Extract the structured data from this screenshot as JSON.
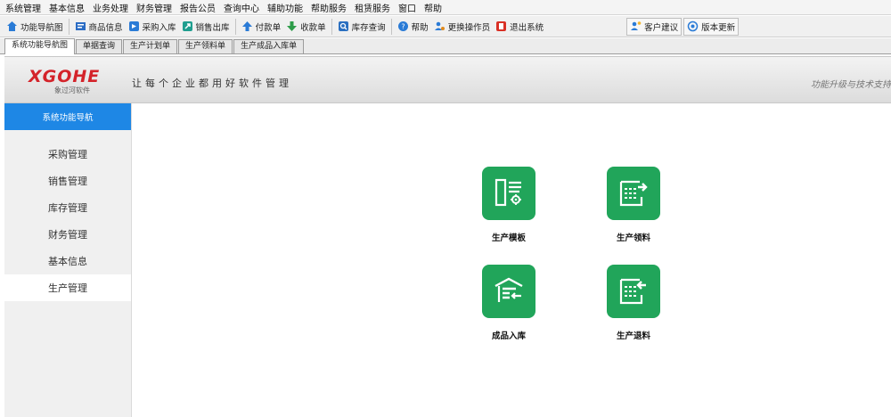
{
  "menu": [
    "系统管理",
    "基本信息",
    "业务处理",
    "财务管理",
    "报告公员",
    "查询中心",
    "辅助功能",
    "帮助服务",
    "租赁服务",
    "窗口",
    "帮助"
  ],
  "toolbar": {
    "items": [
      {
        "label": "功能导航图",
        "icon": "home-icon"
      },
      {
        "label": "商品信息",
        "icon": "goods-icon"
      },
      {
        "label": "采购入库",
        "icon": "purchase-icon"
      },
      {
        "label": "销售出库",
        "icon": "sales-icon"
      },
      {
        "label": "付款单",
        "icon": "payment-icon"
      },
      {
        "label": "收款单",
        "icon": "receipt-icon"
      },
      {
        "label": "库存查询",
        "icon": "stock-search-icon"
      },
      {
        "label": "帮助",
        "icon": "help-icon"
      },
      {
        "label": "更换操作员",
        "icon": "user-switch-icon"
      },
      {
        "label": "退出系统",
        "icon": "exit-icon"
      }
    ],
    "right_items": [
      {
        "label": "客户建议",
        "icon": "customer-icon"
      },
      {
        "label": "版本更新",
        "icon": "update-icon"
      }
    ]
  },
  "tabs": [
    "系统功能导航图",
    "单据查询",
    "生产计划单",
    "生产领料单",
    "生产成品入库单"
  ],
  "banner": {
    "logo": "XGOHE",
    "logo_sub": "象过河软件",
    "slogan": "让每个企业都用好软件管理",
    "right_text": "功能升级与技术支持"
  },
  "sidebar": {
    "header": "系统功能导航",
    "items": [
      "采购管理",
      "销售管理",
      "库存管理",
      "财务管理",
      "基本信息",
      "生产管理"
    ],
    "active_index": 5
  },
  "tiles": [
    {
      "label": "生产模板",
      "icon": "production-template-icon"
    },
    {
      "label": "生产领料",
      "icon": "material-issue-icon"
    },
    {
      "label": "成品入库",
      "icon": "warehouse-in-icon"
    },
    {
      "label": "生产退料",
      "icon": "material-return-icon"
    }
  ],
  "colors": {
    "tile_green": "#21a55a",
    "sidebar_header_blue": "#1e87e5",
    "logo_red": "#d4232a"
  }
}
